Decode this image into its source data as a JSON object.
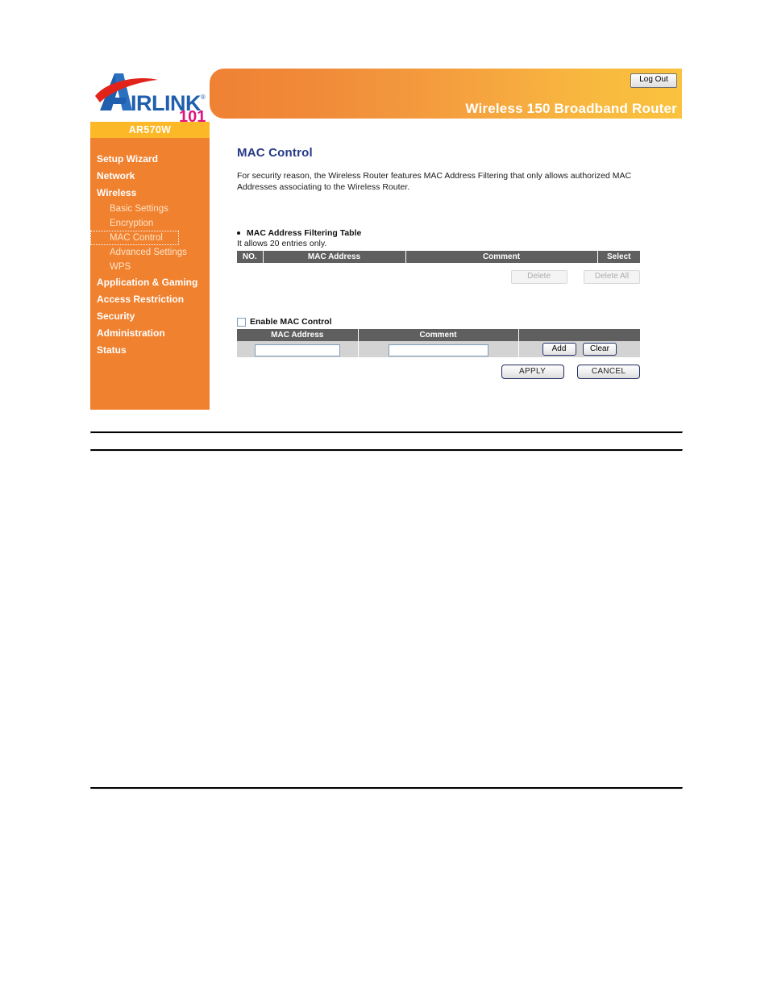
{
  "brand": {
    "logo_name": "AIRLINK",
    "logo_suffix": "101",
    "trademark": "®"
  },
  "header": {
    "logout_label": "Log Out",
    "product_title": "Wireless 150 Broadband Router",
    "accent_left": "#ef8134",
    "accent_right": "#fac23e"
  },
  "sidebar": {
    "model": "AR570W",
    "bg_color": "#f0812f",
    "model_bg_color": "#fdb827",
    "items": [
      {
        "label": "Setup Wizard",
        "level": "top",
        "active": false
      },
      {
        "label": "Network",
        "level": "top",
        "active": false
      },
      {
        "label": "Wireless",
        "level": "top",
        "active": false
      },
      {
        "label": "Basic Settings",
        "level": "sub",
        "active": false
      },
      {
        "label": "Encryption",
        "level": "sub",
        "active": false
      },
      {
        "label": "MAC Control",
        "level": "sub",
        "active": true
      },
      {
        "label": "Advanced Settings",
        "level": "sub",
        "active": false
      },
      {
        "label": "WPS",
        "level": "sub",
        "active": false
      },
      {
        "label": "Application & Gaming",
        "level": "top",
        "active": false
      },
      {
        "label": "Access Restriction",
        "level": "top",
        "active": false
      },
      {
        "label": "Security",
        "level": "top",
        "active": false
      },
      {
        "label": "Administration",
        "level": "top",
        "active": false
      },
      {
        "label": "Status",
        "level": "top",
        "active": false
      }
    ]
  },
  "main": {
    "title": "MAC Control",
    "title_color": "#263a86",
    "intro": "For security reason, the Wireless Router features MAC Address Filtering that only allows authorized MAC Addresses associating to the Wireless Router.",
    "filter_table": {
      "heading": "MAC Address Filtering Table",
      "note": "It allows 20 entries only.",
      "columns": [
        "NO.",
        "MAC Address",
        "Comment",
        "Select"
      ],
      "rows": [],
      "header_bg": "#5f5f5f",
      "delete_label": "Delete",
      "delete_all_label": "Delete All",
      "delete_enabled": false,
      "delete_all_enabled": false
    },
    "enable_control": {
      "label": "Enable MAC Control",
      "checked": false
    },
    "entry_form": {
      "columns": [
        "MAC Address",
        "Comment",
        ""
      ],
      "mac_value": "",
      "mac_placeholder": "",
      "comment_value": "",
      "comment_placeholder": "",
      "add_label": "Add",
      "clear_label": "Clear"
    },
    "footer_buttons": {
      "apply_label": "APPLY",
      "cancel_label": "CANCEL"
    }
  }
}
